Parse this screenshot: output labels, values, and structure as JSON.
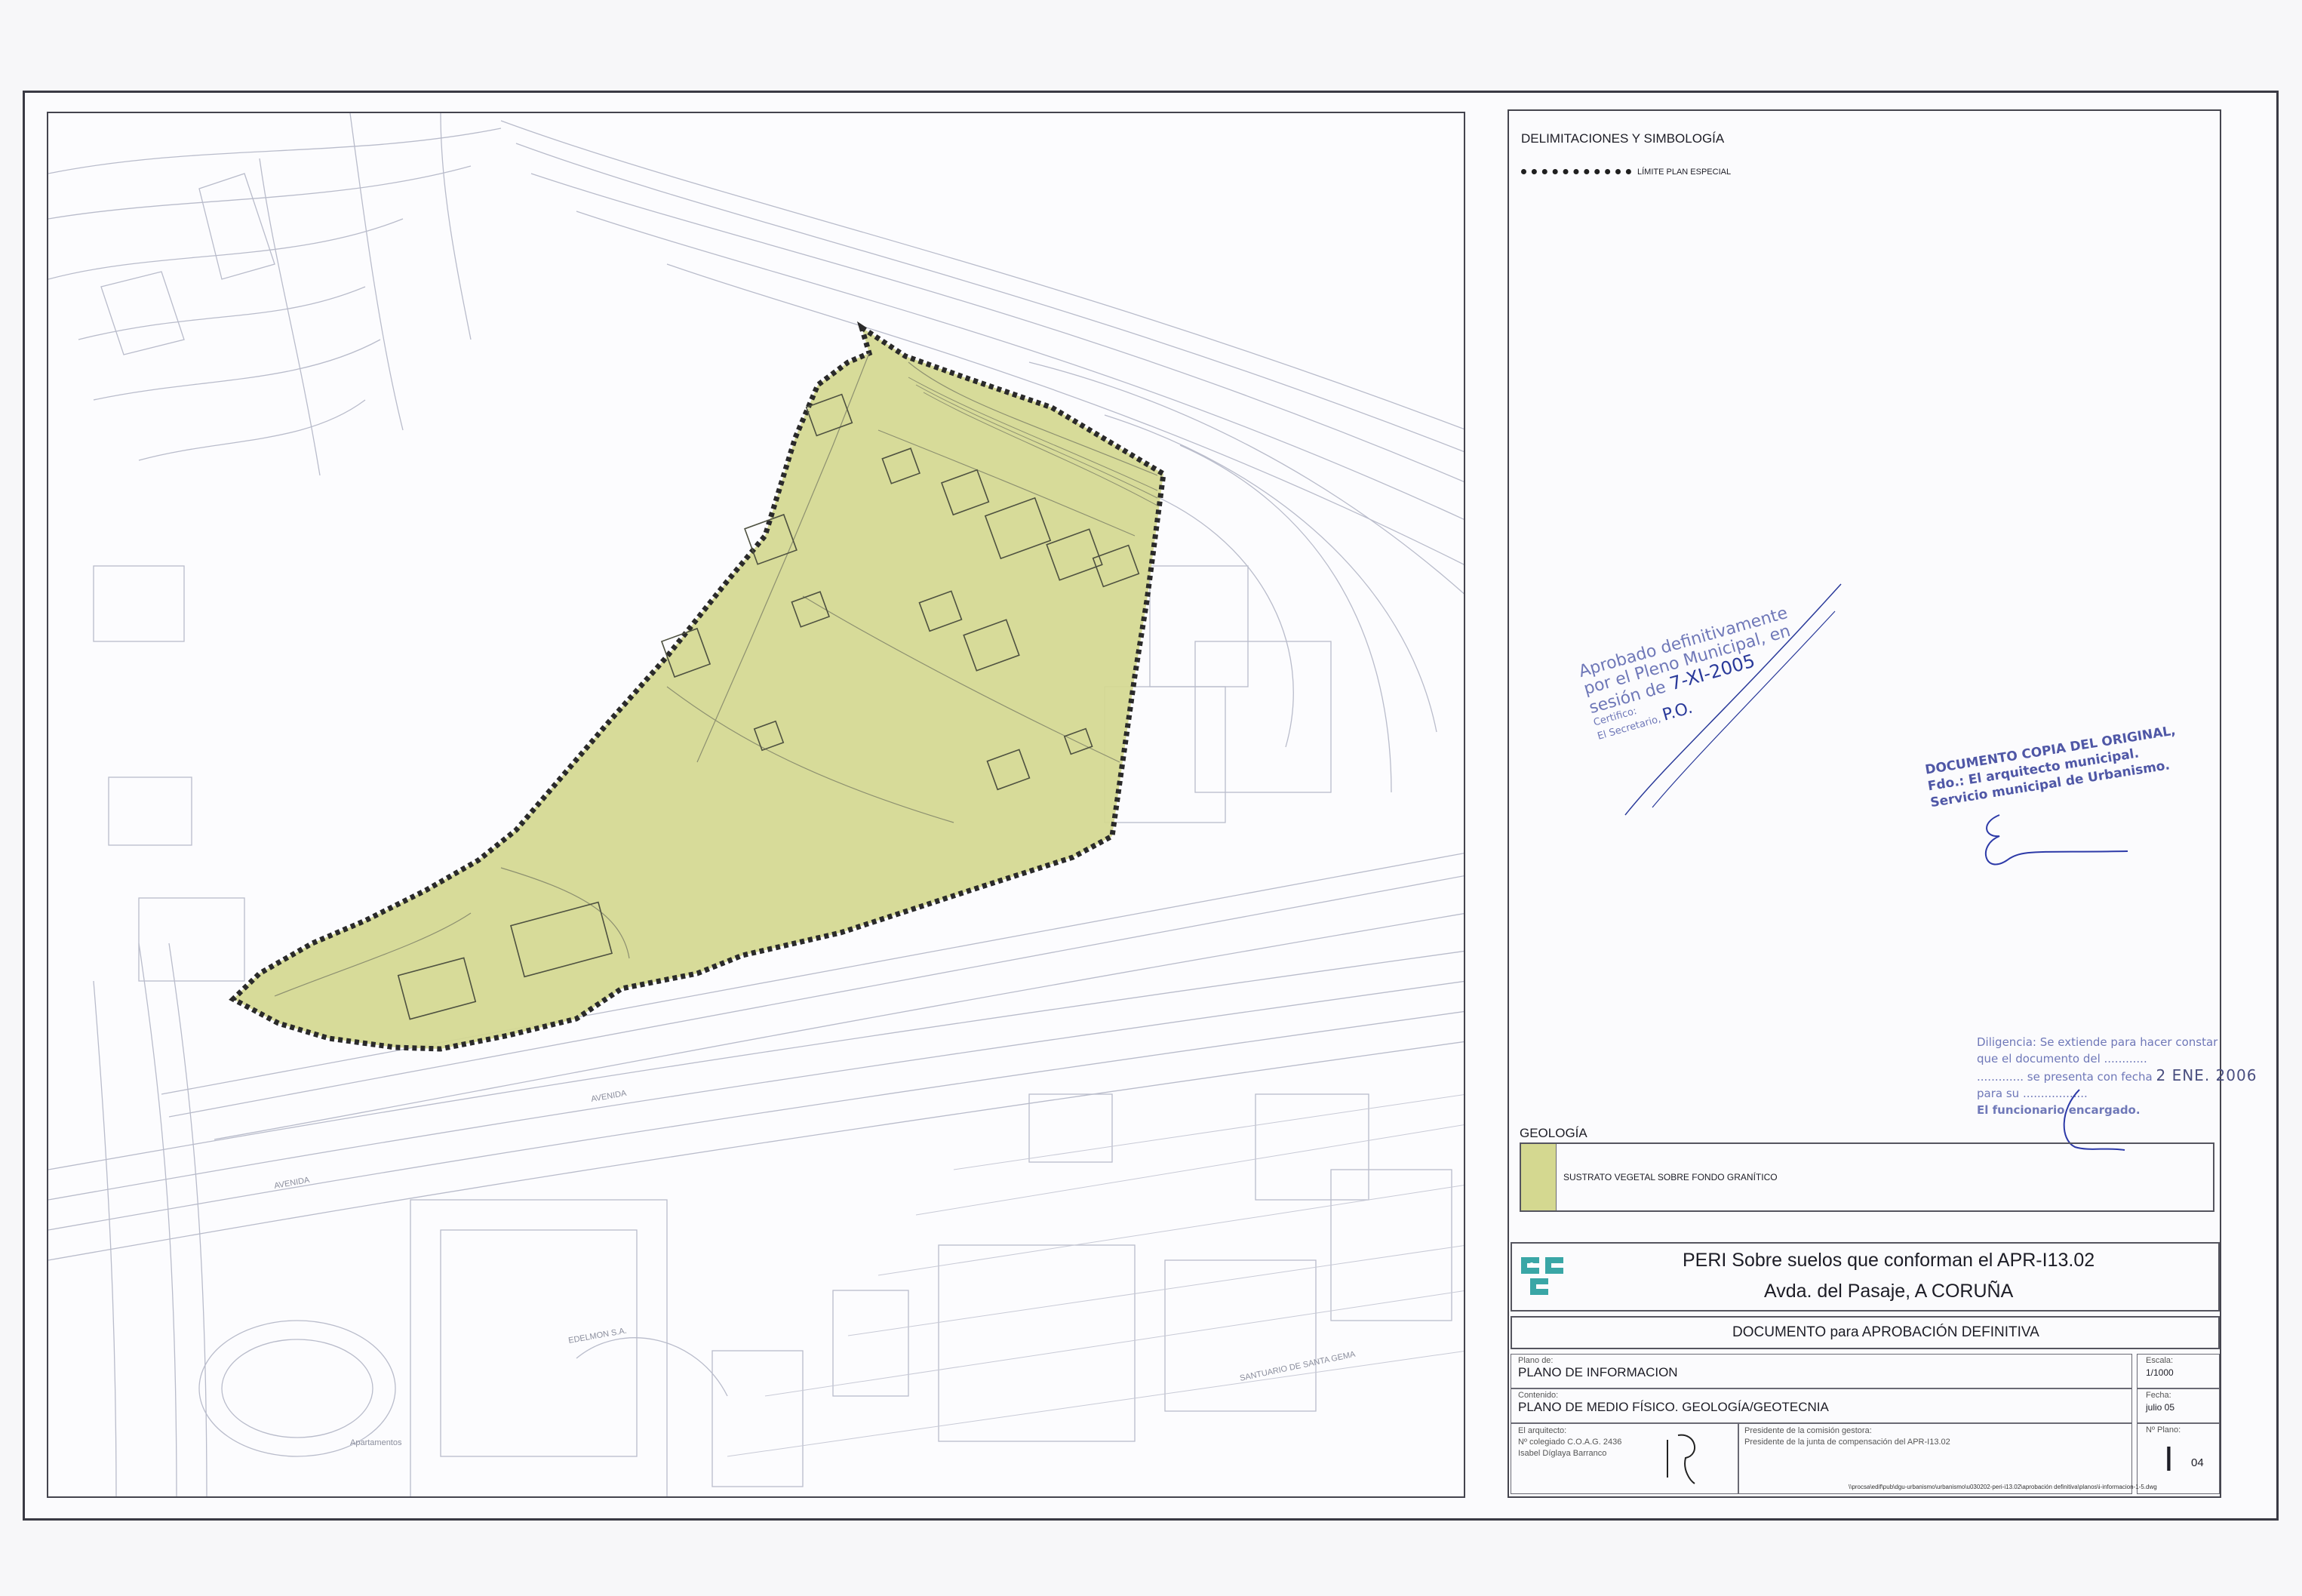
{
  "legend": {
    "section_title": "DELIMITACIONES Y SIMBOLOGÍA",
    "boundary_label": "LÍMITE PLAN ESPECIAL",
    "geology_title": "GEOLOGÍA",
    "geology_item": "SUSTRATO VEGETAL SOBRE FONDO GRANÍTICO",
    "geology_color": "#d4d890"
  },
  "stamps": {
    "approval": {
      "line1": "Aprobado definitivamente",
      "line2": "por el Pleno Municipal, en",
      "line3": "sesión de",
      "date": "7-XI-2005",
      "line4": "Certifico:",
      "line5": "El Secretario,",
      "signature_note": "P.O."
    },
    "copy": {
      "line1": "DOCUMENTO COPIA DEL ORIGINAL,",
      "line2": "Fdo.: El arquitecto municipal.",
      "line3": "Servicio municipal de Urbanismo."
    },
    "diligencia": {
      "line1": "Diligencia: Se extiende para hacer constar",
      "line2": "que el documento del",
      "line3": "se presenta con fecha",
      "date": "2 ENE. 2006",
      "line4": "para su",
      "line5": "El funcionario encargado."
    }
  },
  "title_block": {
    "project_line1": "PERI Sobre suelos que conforman el APR-I13.02",
    "project_line2": "Avda. del Pasaje,   A CORUÑA",
    "document": "DOCUMENTO para APROBACIÓN DEFINITIVA",
    "plano_label": "Plano de:",
    "plano_value": "PLANO DE INFORMACION",
    "contenido_label": "Contenido:",
    "contenido_value": "PLANO DE MEDIO FÍSICO. GEOLOGÍA/GEOTECNIA",
    "escala_label": "Escala:",
    "escala_value": "1/1000",
    "fecha_label": "Fecha:",
    "fecha_value": "julio 05",
    "arquitecto_label": "El arquitecto:",
    "arquitecto_line1": "Nº colegiado C.O.A.G. 2436",
    "arquitecto_line2": "Isabel Díglaya Barranco",
    "presidente_label": "Presidente de la comisión gestora:",
    "presidente_value": "Presidente de la junta de compensación del APR-I13.02",
    "numero_label": "Nº Plano:",
    "numero_value": "I",
    "numero_sub": "04",
    "file_path": "\\\\procsa\\edif\\pub\\dgu-urbanismo\\urbanismo\\u030202-peri-i13.02\\aprobación definitiva\\planos\\i-informacion-1-5.dwg"
  },
  "map": {
    "labels": [
      "AVENIDA",
      "AVENIDA",
      "EDELMON S.A.",
      "SANTUARIO DE SANTA GEMA",
      "Apartamentos"
    ]
  }
}
